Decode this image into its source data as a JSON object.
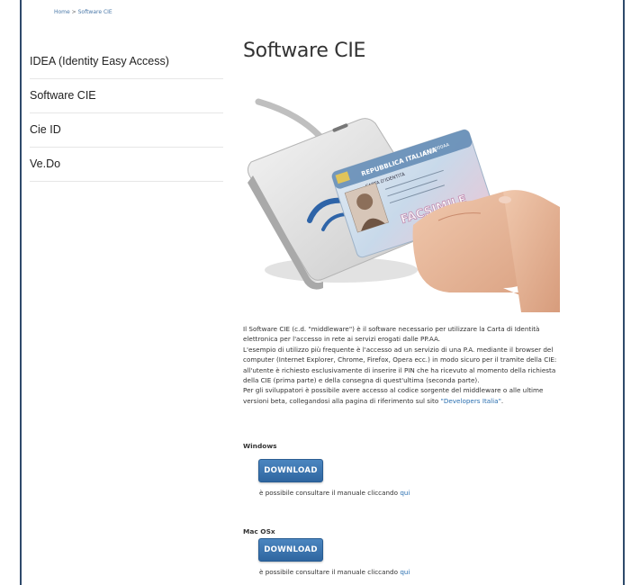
{
  "breadcrumb": {
    "home": "Home",
    "separator": ">",
    "current": "Software CIE"
  },
  "sidebar": {
    "items": [
      {
        "label": "IDEA (Identity Easy Access)"
      },
      {
        "label": "Software CIE"
      },
      {
        "label": "Cie ID"
      },
      {
        "label": "Ve.Do"
      }
    ]
  },
  "main": {
    "title": "Software CIE",
    "hero_card_text": "REPUBBLICA ITALIANA",
    "hero_card_sub": "CARTA D'IDENTITÀ",
    "hero_card_stamp": "FACSIMILE",
    "hero_card_number": "CA00000AA",
    "paragraphs": [
      "Il Software CIE (c.d. \"middleware\") è il software necessario per utilizzare la Carta di Identità elettronica per l'accesso in rete ai servizi erogati dalle PP.AA.",
      "L'esempio di utilizzo più frequente è l'accesso ad un servizio di una P.A. mediante il browser del computer (Internet Explorer, Chrome, Firefox, Opera ecc.) in modo sicuro per il tramite della CIE: all'utente è richiesto esclusivamente di inserire il PIN che ha ricevuto al momento della richiesta della CIE (prima parte) e della consegna di quest'ultima (seconda parte)."
    ],
    "devs_text_before": "Per gli sviluppatori è possibile avere accesso al codice sorgente del middleware o alle ultime versioni beta, collegandosi alla pagina di riferimento sul sito ",
    "devs_link": "\"Developers Italia\"",
    "devs_text_after": ".",
    "downloads": [
      {
        "os": "Windows",
        "button": "DOWNLOAD",
        "manual_text": "è possibile consultare il manuale cliccando ",
        "manual_link": "qui"
      },
      {
        "os": "Mac OSx",
        "button": "DOWNLOAD",
        "manual_text": "è possibile consultare il manuale cliccando ",
        "manual_link": "qui"
      }
    ]
  },
  "colors": {
    "link": "#2a6fb0",
    "button": "#3a74ad",
    "frame": "#2e4a6b"
  }
}
